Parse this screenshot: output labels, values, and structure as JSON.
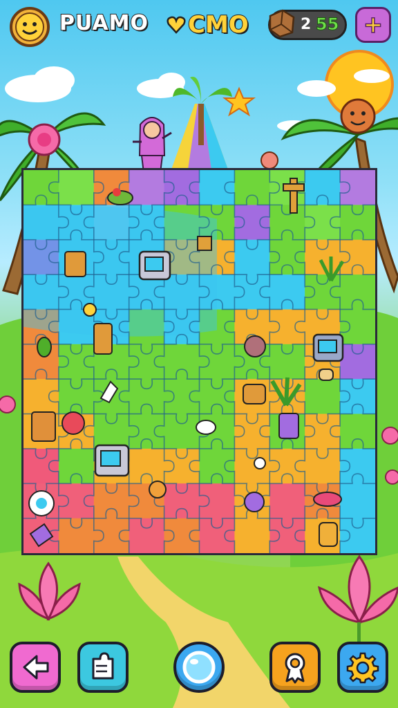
{
  "header": {
    "left_title": "PUAMO",
    "center_title": "CMO",
    "counter_value": "2",
    "currency_value": "55",
    "plus_label": "+"
  },
  "board": {
    "cols": 10,
    "rows": 11,
    "colors": [
      [
        "#6fd63a",
        "#7be04a",
        "#f08a3c",
        "#b37be0",
        "#a26ce0",
        "#3ccaf0",
        "#6fd63a",
        "#7be04a",
        "#3ccaf0",
        "#b37be0"
      ],
      [
        "#3ccaf0",
        "#3ccaf0",
        "#5fc8f0",
        "#3ccaf0",
        "#6fd63a",
        "#6fd63a",
        "#a26ce0",
        "#6fd63a",
        "#7be04a",
        "#6fd63a"
      ],
      [
        "#a26ce0",
        "#3ccaf0",
        "#3ccaf0",
        "#3ccaf0",
        "#f6b12e",
        "#f6b12e",
        "#3ccaf0",
        "#6fd63a",
        "#f6b12e",
        "#f6b12e"
      ],
      [
        "#3ccaf0",
        "#3ccaf0",
        "#3ccaf0",
        "#3ccaf0",
        "#3ccaf0",
        "#3ccaf0",
        "#3ccaf0",
        "#3ccaf0",
        "#6fd63a",
        "#6fd63a"
      ],
      [
        "#f08a3c",
        "#3ccaf0",
        "#3ccaf0",
        "#6fd63a",
        "#3ccaf0",
        "#6fd63a",
        "#f6b12e",
        "#f6b12e",
        "#f6b12e",
        "#6fd63a"
      ],
      [
        "#f08a3c",
        "#6fd63a",
        "#6fd63a",
        "#6fd63a",
        "#6fd63a",
        "#6fd63a",
        "#6fd63a",
        "#6fd63a",
        "#f6b12e",
        "#a26ce0"
      ],
      [
        "#f6b12e",
        "#6fd63a",
        "#6fd63a",
        "#6fd63a",
        "#6fd63a",
        "#6fd63a",
        "#f6b12e",
        "#f6b12e",
        "#6fd63a",
        "#3ccaf0"
      ],
      [
        "#f6b12e",
        "#f6b12e",
        "#6fd63a",
        "#6fd63a",
        "#6fd63a",
        "#6fd63a",
        "#f6b12e",
        "#6fd63a",
        "#f6b12e",
        "#6fd63a"
      ],
      [
        "#f05a7a",
        "#6fd63a",
        "#f6b12e",
        "#f6b12e",
        "#f6b12e",
        "#6fd63a",
        "#f6b12e",
        "#f6b12e",
        "#f6b12e",
        "#3ccaf0"
      ],
      [
        "#f0607a",
        "#f0607a",
        "#f08a3c",
        "#f08a3c",
        "#f0607a",
        "#f0607a",
        "#f6b12e",
        "#f0607a",
        "#f08a3c",
        "#3ccaf0"
      ],
      [
        "#f0607a",
        "#f08a3c",
        "#f08a3c",
        "#f0607a",
        "#f08a3c",
        "#f0607a",
        "#f6b12e",
        "#f0607a",
        "#f6b12e",
        "#3ccaf0"
      ]
    ],
    "line_color": "#1f5f8f",
    "water_color": "#39c3ef"
  },
  "buttons": [
    {
      "icon": "back-arrow-icon",
      "color": "#f06ad0"
    },
    {
      "icon": "puzzle-piece-icon",
      "color": "#3cc8e0"
    },
    {
      "icon": "bubble-icon",
      "color": "#3ca8f0"
    },
    {
      "icon": "award-ribbon-icon",
      "color": "#f6a21e"
    },
    {
      "icon": "gear-icon",
      "color": "#3ca8f0"
    }
  ]
}
